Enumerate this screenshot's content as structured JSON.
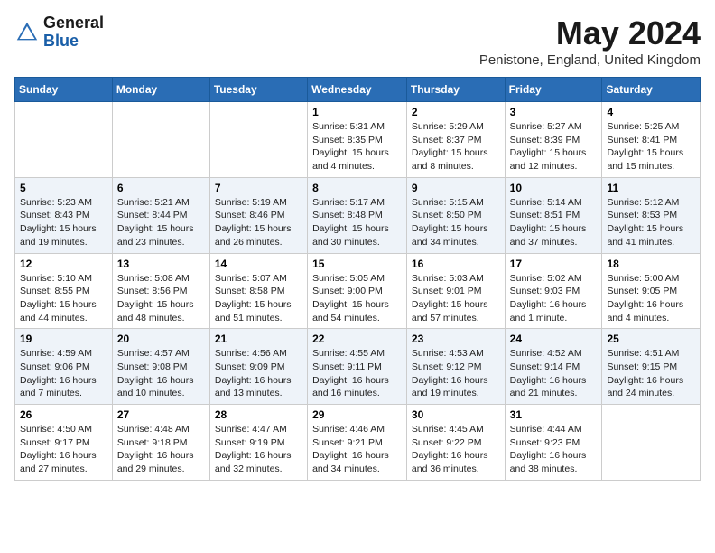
{
  "header": {
    "logo_general": "General",
    "logo_blue": "Blue",
    "month_title": "May 2024",
    "location": "Penistone, England, United Kingdom"
  },
  "days_of_week": [
    "Sunday",
    "Monday",
    "Tuesday",
    "Wednesday",
    "Thursday",
    "Friday",
    "Saturday"
  ],
  "weeks": [
    [
      {
        "day": "",
        "sunrise": "",
        "sunset": "",
        "daylight": ""
      },
      {
        "day": "",
        "sunrise": "",
        "sunset": "",
        "daylight": ""
      },
      {
        "day": "",
        "sunrise": "",
        "sunset": "",
        "daylight": ""
      },
      {
        "day": "1",
        "sunrise": "Sunrise: 5:31 AM",
        "sunset": "Sunset: 8:35 PM",
        "daylight": "Daylight: 15 hours and 4 minutes."
      },
      {
        "day": "2",
        "sunrise": "Sunrise: 5:29 AM",
        "sunset": "Sunset: 8:37 PM",
        "daylight": "Daylight: 15 hours and 8 minutes."
      },
      {
        "day": "3",
        "sunrise": "Sunrise: 5:27 AM",
        "sunset": "Sunset: 8:39 PM",
        "daylight": "Daylight: 15 hours and 12 minutes."
      },
      {
        "day": "4",
        "sunrise": "Sunrise: 5:25 AM",
        "sunset": "Sunset: 8:41 PM",
        "daylight": "Daylight: 15 hours and 15 minutes."
      }
    ],
    [
      {
        "day": "5",
        "sunrise": "Sunrise: 5:23 AM",
        "sunset": "Sunset: 8:43 PM",
        "daylight": "Daylight: 15 hours and 19 minutes."
      },
      {
        "day": "6",
        "sunrise": "Sunrise: 5:21 AM",
        "sunset": "Sunset: 8:44 PM",
        "daylight": "Daylight: 15 hours and 23 minutes."
      },
      {
        "day": "7",
        "sunrise": "Sunrise: 5:19 AM",
        "sunset": "Sunset: 8:46 PM",
        "daylight": "Daylight: 15 hours and 26 minutes."
      },
      {
        "day": "8",
        "sunrise": "Sunrise: 5:17 AM",
        "sunset": "Sunset: 8:48 PM",
        "daylight": "Daylight: 15 hours and 30 minutes."
      },
      {
        "day": "9",
        "sunrise": "Sunrise: 5:15 AM",
        "sunset": "Sunset: 8:50 PM",
        "daylight": "Daylight: 15 hours and 34 minutes."
      },
      {
        "day": "10",
        "sunrise": "Sunrise: 5:14 AM",
        "sunset": "Sunset: 8:51 PM",
        "daylight": "Daylight: 15 hours and 37 minutes."
      },
      {
        "day": "11",
        "sunrise": "Sunrise: 5:12 AM",
        "sunset": "Sunset: 8:53 PM",
        "daylight": "Daylight: 15 hours and 41 minutes."
      }
    ],
    [
      {
        "day": "12",
        "sunrise": "Sunrise: 5:10 AM",
        "sunset": "Sunset: 8:55 PM",
        "daylight": "Daylight: 15 hours and 44 minutes."
      },
      {
        "day": "13",
        "sunrise": "Sunrise: 5:08 AM",
        "sunset": "Sunset: 8:56 PM",
        "daylight": "Daylight: 15 hours and 48 minutes."
      },
      {
        "day": "14",
        "sunrise": "Sunrise: 5:07 AM",
        "sunset": "Sunset: 8:58 PM",
        "daylight": "Daylight: 15 hours and 51 minutes."
      },
      {
        "day": "15",
        "sunrise": "Sunrise: 5:05 AM",
        "sunset": "Sunset: 9:00 PM",
        "daylight": "Daylight: 15 hours and 54 minutes."
      },
      {
        "day": "16",
        "sunrise": "Sunrise: 5:03 AM",
        "sunset": "Sunset: 9:01 PM",
        "daylight": "Daylight: 15 hours and 57 minutes."
      },
      {
        "day": "17",
        "sunrise": "Sunrise: 5:02 AM",
        "sunset": "Sunset: 9:03 PM",
        "daylight": "Daylight: 16 hours and 1 minute."
      },
      {
        "day": "18",
        "sunrise": "Sunrise: 5:00 AM",
        "sunset": "Sunset: 9:05 PM",
        "daylight": "Daylight: 16 hours and 4 minutes."
      }
    ],
    [
      {
        "day": "19",
        "sunrise": "Sunrise: 4:59 AM",
        "sunset": "Sunset: 9:06 PM",
        "daylight": "Daylight: 16 hours and 7 minutes."
      },
      {
        "day": "20",
        "sunrise": "Sunrise: 4:57 AM",
        "sunset": "Sunset: 9:08 PM",
        "daylight": "Daylight: 16 hours and 10 minutes."
      },
      {
        "day": "21",
        "sunrise": "Sunrise: 4:56 AM",
        "sunset": "Sunset: 9:09 PM",
        "daylight": "Daylight: 16 hours and 13 minutes."
      },
      {
        "day": "22",
        "sunrise": "Sunrise: 4:55 AM",
        "sunset": "Sunset: 9:11 PM",
        "daylight": "Daylight: 16 hours and 16 minutes."
      },
      {
        "day": "23",
        "sunrise": "Sunrise: 4:53 AM",
        "sunset": "Sunset: 9:12 PM",
        "daylight": "Daylight: 16 hours and 19 minutes."
      },
      {
        "day": "24",
        "sunrise": "Sunrise: 4:52 AM",
        "sunset": "Sunset: 9:14 PM",
        "daylight": "Daylight: 16 hours and 21 minutes."
      },
      {
        "day": "25",
        "sunrise": "Sunrise: 4:51 AM",
        "sunset": "Sunset: 9:15 PM",
        "daylight": "Daylight: 16 hours and 24 minutes."
      }
    ],
    [
      {
        "day": "26",
        "sunrise": "Sunrise: 4:50 AM",
        "sunset": "Sunset: 9:17 PM",
        "daylight": "Daylight: 16 hours and 27 minutes."
      },
      {
        "day": "27",
        "sunrise": "Sunrise: 4:48 AM",
        "sunset": "Sunset: 9:18 PM",
        "daylight": "Daylight: 16 hours and 29 minutes."
      },
      {
        "day": "28",
        "sunrise": "Sunrise: 4:47 AM",
        "sunset": "Sunset: 9:19 PM",
        "daylight": "Daylight: 16 hours and 32 minutes."
      },
      {
        "day": "29",
        "sunrise": "Sunrise: 4:46 AM",
        "sunset": "Sunset: 9:21 PM",
        "daylight": "Daylight: 16 hours and 34 minutes."
      },
      {
        "day": "30",
        "sunrise": "Sunrise: 4:45 AM",
        "sunset": "Sunset: 9:22 PM",
        "daylight": "Daylight: 16 hours and 36 minutes."
      },
      {
        "day": "31",
        "sunrise": "Sunrise: 4:44 AM",
        "sunset": "Sunset: 9:23 PM",
        "daylight": "Daylight: 16 hours and 38 minutes."
      },
      {
        "day": "",
        "sunrise": "",
        "sunset": "",
        "daylight": ""
      }
    ]
  ]
}
